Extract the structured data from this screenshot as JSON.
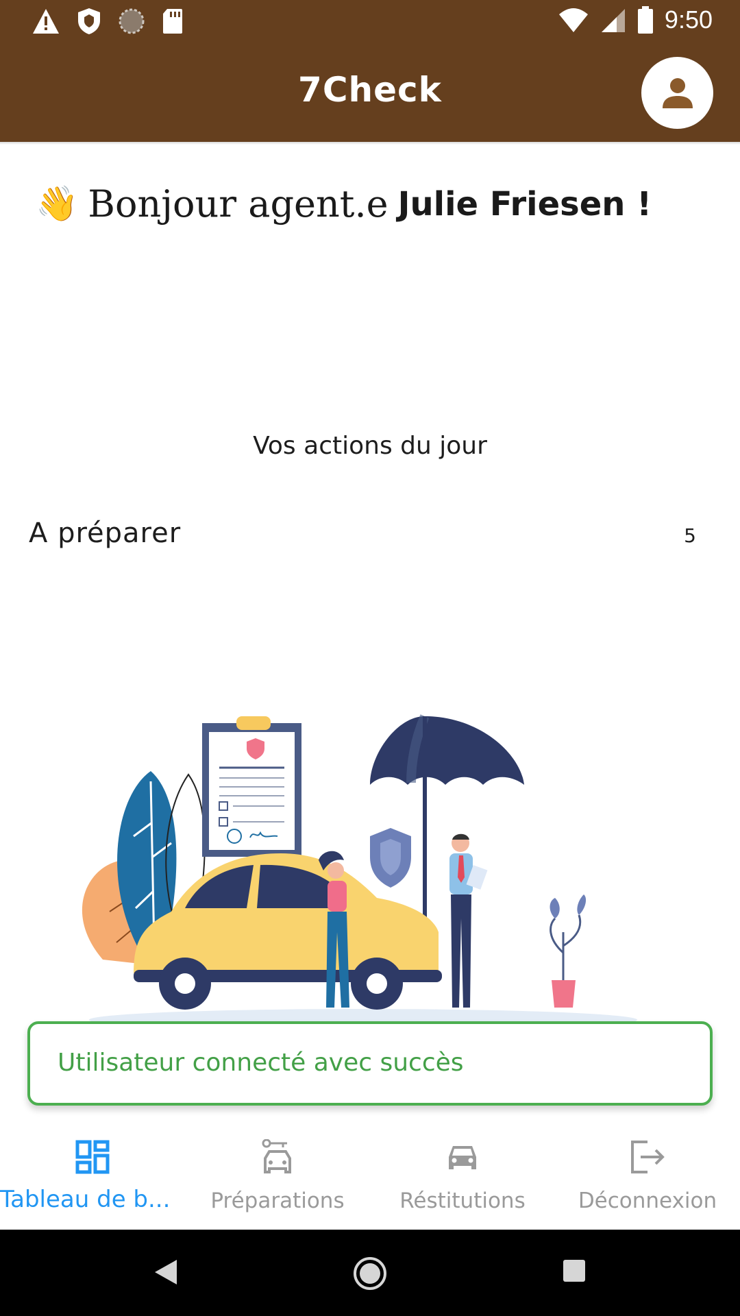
{
  "status_bar": {
    "time": "9:50",
    "left_icons": [
      "alert-icon",
      "shield-icon",
      "sync-icon",
      "sd-card-icon"
    ],
    "right_icons": [
      "wifi-icon",
      "signal-icon",
      "battery-icon"
    ]
  },
  "app_bar": {
    "title": "7Check",
    "avatar_icon": "person-icon"
  },
  "greeting": {
    "emoji": "👋",
    "hello": "Bonjour agent.e",
    "name": "Julie Friesen !"
  },
  "dashboard": {
    "actions_title": "Vos actions du jour",
    "items": [
      {
        "label": "A préparer",
        "count": "5"
      }
    ]
  },
  "toast": {
    "message": "Utilisateur connecté avec succès",
    "color": "#4caf50"
  },
  "bottom_nav": {
    "items": [
      {
        "label": "Tableau de b...",
        "icon": "dashboard-icon",
        "active": true
      },
      {
        "label": "Préparations",
        "icon": "car-key-icon",
        "active": false
      },
      {
        "label": "Réstitutions",
        "icon": "car-icon",
        "active": false
      },
      {
        "label": "Déconnexion",
        "icon": "logout-icon",
        "active": false
      }
    ]
  },
  "colors": {
    "brand": "#653f1e",
    "active": "#2196f3",
    "inactive": "#9a9a9a"
  }
}
